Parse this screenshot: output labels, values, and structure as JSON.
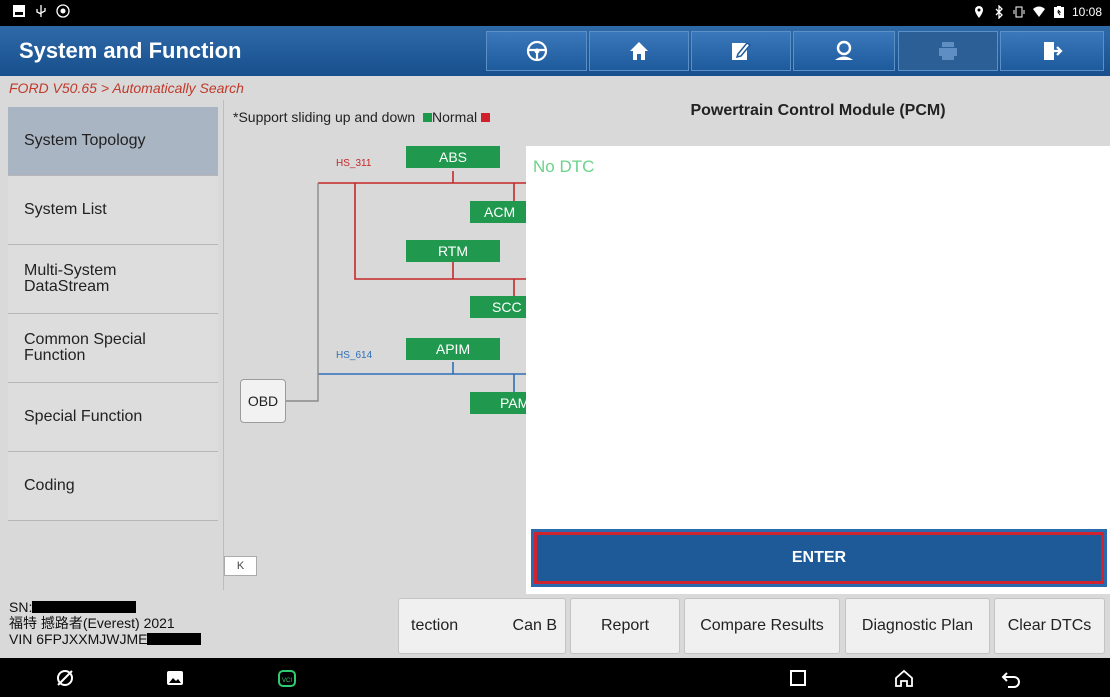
{
  "header": {
    "title": "System and Function"
  },
  "status_bar": {
    "time": "10:08"
  },
  "breadcrumb": "FORD V50.65 > Automatically Search",
  "sidebar": {
    "items": [
      {
        "label": "System Topology"
      },
      {
        "label": "System List"
      },
      {
        "label": "Multi-System\nDataStream"
      },
      {
        "label": "Common Special\nFunction"
      },
      {
        "label": "Special Function"
      },
      {
        "label": "Coding"
      }
    ]
  },
  "topology": {
    "legend_prefix": "*Support sliding up and down ",
    "legend_normal": "Normal",
    "bus_hs311": "HS_311",
    "bus_hs614": "HS_614",
    "obd": "OBD",
    "nodes": {
      "abs": "ABS",
      "acm": "ACM",
      "rtm": "RTM",
      "scc": "SCC",
      "apim": "APIM",
      "pam": "PAM"
    },
    "collapse": "K",
    "colors": {
      "hs311": "#c62828",
      "hs614": "#2f6fb8",
      "node": "#20994e"
    }
  },
  "panel": {
    "title": "Powertrain Control Module (PCM)",
    "message": "No DTC",
    "enter": "ENTER"
  },
  "vehicle": {
    "sn_label": "SN:",
    "model": "福特 撼路者(Everest) 2021",
    "vin_prefix": "VIN 6FPJXXMJWJME"
  },
  "bottom_buttons": {
    "detection": "tection",
    "can_bus": "Can B",
    "report": "Report",
    "compare": "Compare Results",
    "plan": "Diagnostic Plan",
    "clear": "Clear DTCs"
  },
  "icons": {
    "header": [
      "steering-wheel-icon",
      "home-icon",
      "edit-icon",
      "user-support-icon",
      "printer-icon",
      "exit-icon"
    ],
    "nav": [
      "browser-icon",
      "gallery-icon",
      "vci-icon",
      "recent-apps-icon",
      "home-icon",
      "back-icon"
    ]
  }
}
